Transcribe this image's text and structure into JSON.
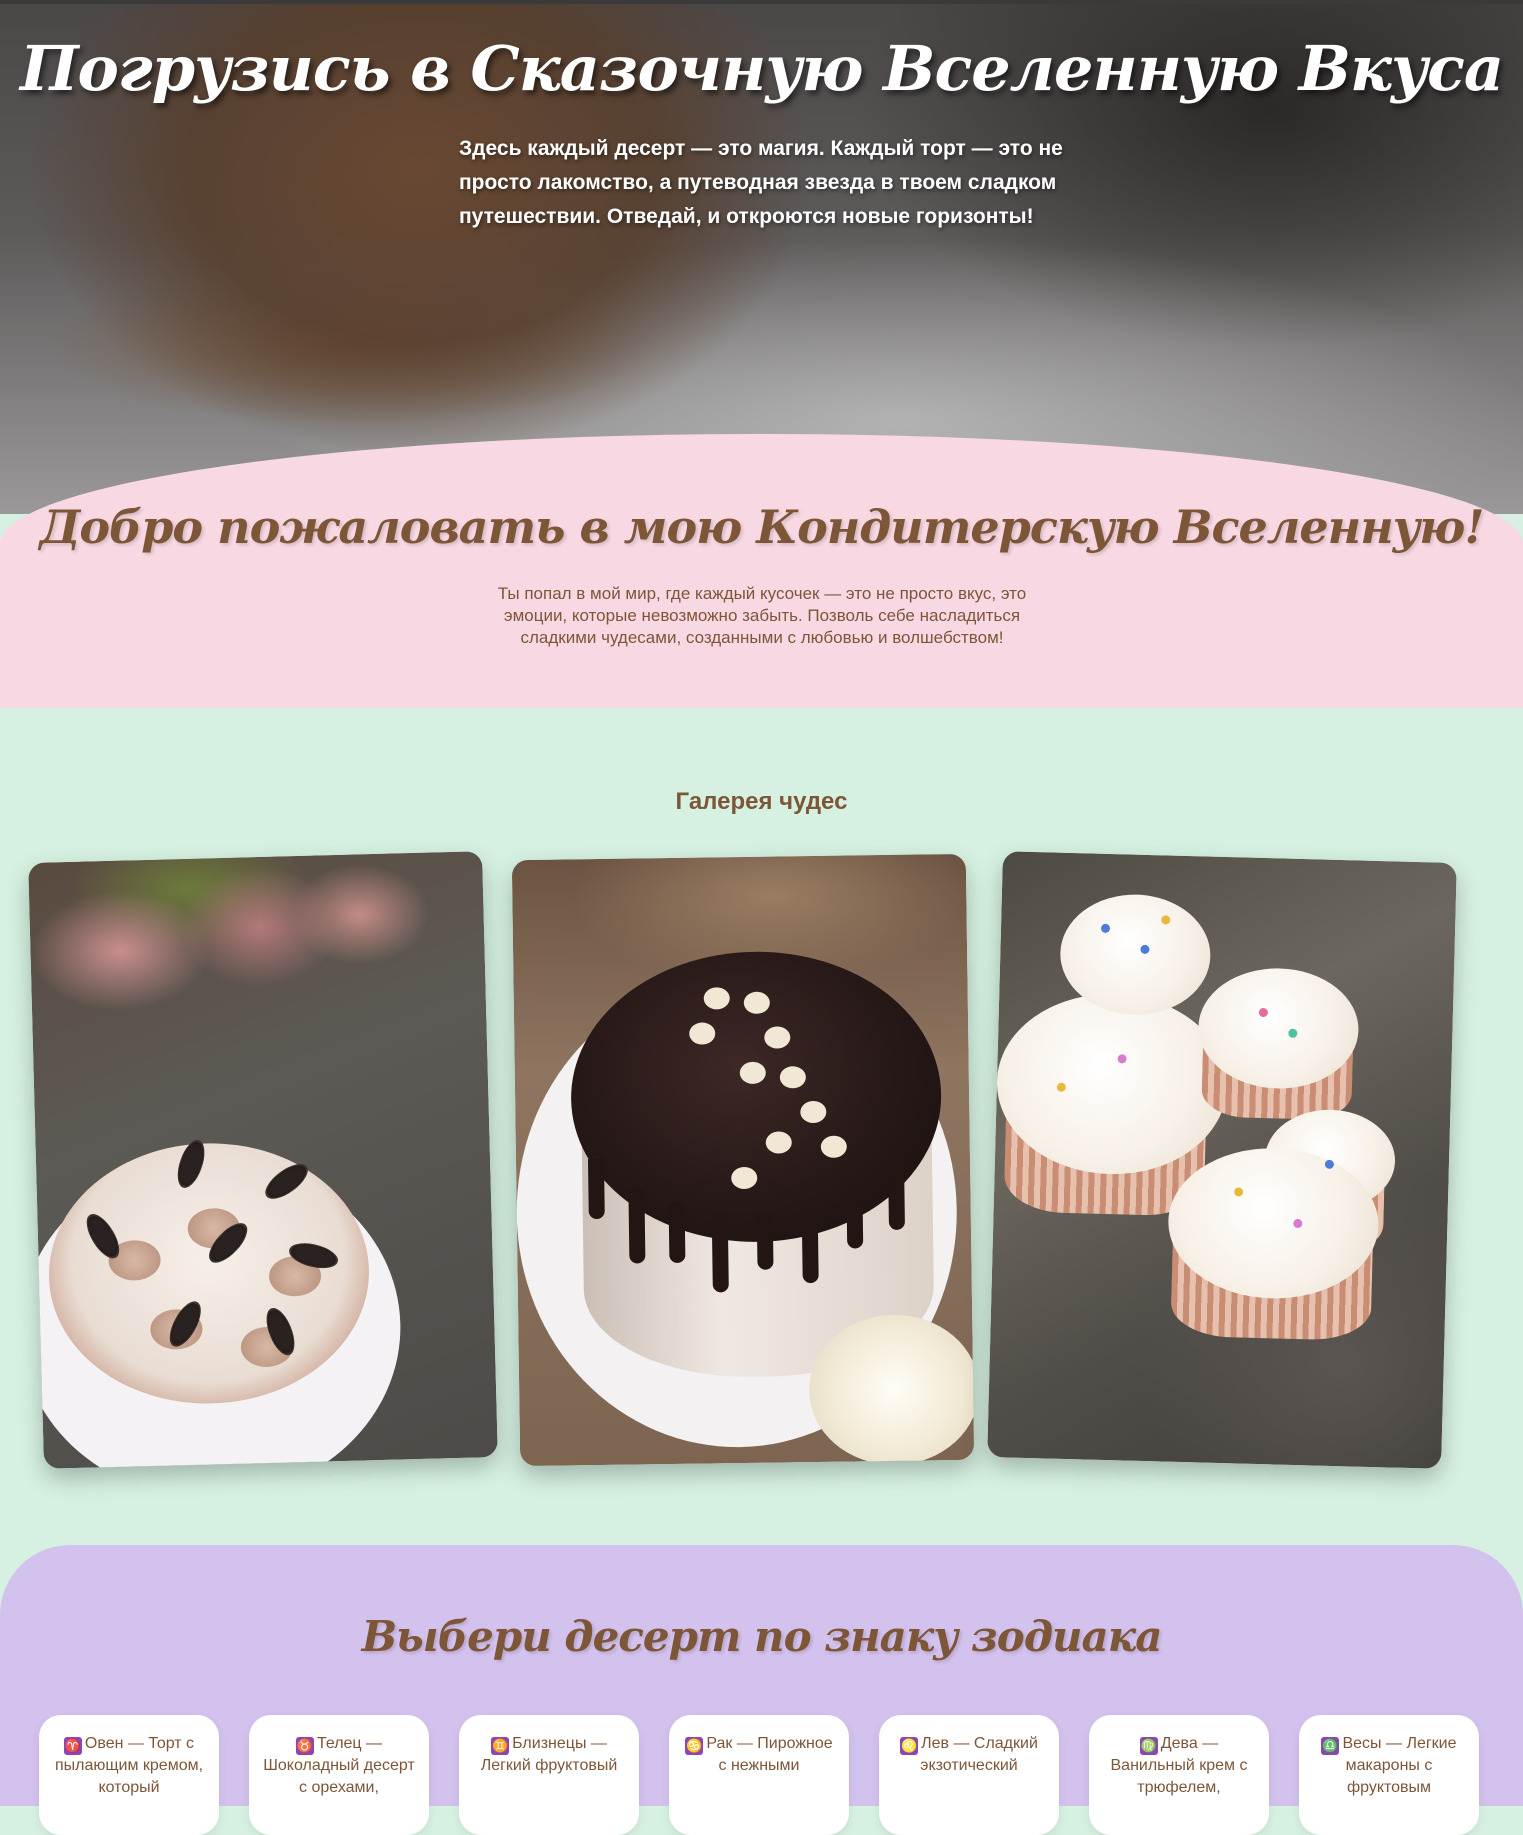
{
  "hero": {
    "title": "Погрузись в Сказочную Вселенную Вкуса",
    "text": "Здесь каждый десерт — это магия. Каждый торт — это не просто лакомство, а путеводная звезда в твоем сладком путешествии. Отведай, и откроются новые горизонты!"
  },
  "welcome": {
    "title": "Добро пожаловать в мою Кондитерскую Вселенную!",
    "text": "Ты попал в мой мир, где каждый кусочек — это не просто вкус, это эмоции, которые невозможно забыть. Позволь себе насладиться сладкими чудесами, созданными с любовью и волшебством!"
  },
  "gallery": {
    "title": "Галерея чудес"
  },
  "zodiac": {
    "title": "Выбери десерт по знаку зодиака",
    "cards": [
      {
        "symbol": "♈",
        "text": "Овен — Торт с пылающим кремом, который"
      },
      {
        "symbol": "♉",
        "text": "Телец — Шоколадный десерт с орехами,"
      },
      {
        "symbol": "♊",
        "text": "Близнецы — Легкий фруктовый"
      },
      {
        "symbol": "♋",
        "text": "Рак — Пирожное с нежными"
      },
      {
        "symbol": "♌",
        "text": "Лев — Сладкий экзотический"
      },
      {
        "symbol": "♍",
        "text": "Дева — Ванильный крем с трюфелем,"
      },
      {
        "symbol": "♎",
        "text": "Весы — Легкие макароны с фруктовым"
      }
    ]
  }
}
